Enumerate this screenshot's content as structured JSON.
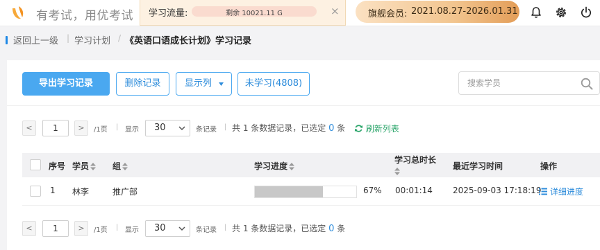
{
  "header": {
    "brand": "有考试，用优考试",
    "flow_label": "学习流量:",
    "flow_remaining": "剩余 10021.11 G",
    "flow_close": "×",
    "vip_label": "旗舰会员:",
    "vip_period": "2021.08.27-2026.01.31",
    "icons": [
      "bell-icon",
      "gear-icon",
      "power-icon"
    ]
  },
  "breadcrumb": {
    "back": "返回上一级",
    "sep1": "|",
    "plan": "学习计划",
    "sep2": "/",
    "current": "《英语口语成长计划》学习记录"
  },
  "toolbar": {
    "export": "导出学习记录",
    "delete": "删除记录",
    "columns": "显示列",
    "unlearned": "未学习(4808)",
    "search_placeholder": "搜索学员"
  },
  "pager": {
    "prev": "<",
    "page": "1",
    "next": ">",
    "total_pages": "/1页",
    "sep": "|",
    "show": "显示",
    "page_size": "30",
    "records_unit": "条记录",
    "summary": "共 1 条数据记录，已选定",
    "selected": "0",
    "selected_unit": "条",
    "refresh": "刷新列表"
  },
  "table": {
    "columns": [
      "序号",
      "学员",
      "组",
      "学习进度",
      "学习总时长",
      "最近学习时间",
      "操作"
    ],
    "rows": [
      {
        "index": "1",
        "name": "林李",
        "group": "推广部",
        "progress": 0.67,
        "progress_label": "67%",
        "duration": "00:01:14",
        "last_time": "2025-09-03 17:18:19",
        "action": "详细进度"
      }
    ]
  },
  "colors": {
    "primary": "#4aa8f0",
    "link": "#2d8cdb",
    "refresh": "#2aa56a",
    "vip_gradient_end": "#e39d58"
  }
}
